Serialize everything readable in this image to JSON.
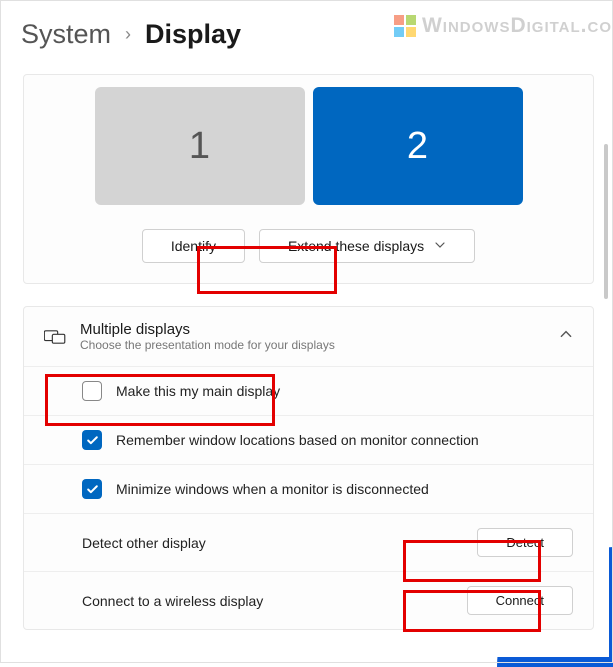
{
  "watermark": {
    "text": "WindowsDigital.co"
  },
  "breadcrumb": {
    "parent": "System",
    "separator": "›",
    "current": "Display"
  },
  "monitors": {
    "display1": "1",
    "display2": "2"
  },
  "controls": {
    "identify": "Identify",
    "mode_label": "Extend these displays"
  },
  "section": {
    "title": "Multiple displays",
    "subtitle": "Choose the presentation mode for your displays"
  },
  "rows": {
    "main_display": "Make this my main display",
    "remember": "Remember window locations based on monitor connection",
    "minimize": "Minimize windows when a monitor is disconnected",
    "detect_label": "Detect other display",
    "detect_btn": "Detect",
    "connect_label": "Connect to a wireless display",
    "connect_btn": "Connect"
  }
}
